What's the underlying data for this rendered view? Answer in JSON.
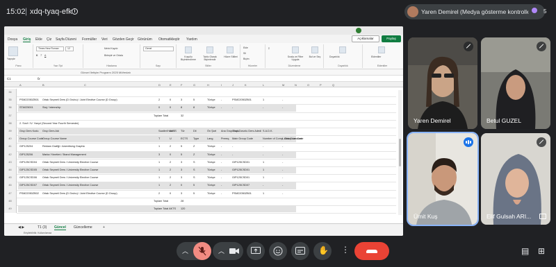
{
  "meet": {
    "time": "15:02",
    "meeting_code": "xdq-tyaq-efk",
    "presenter_label": "Yaren Demirel (Medya gösterme kontrolleri)",
    "participant_count": "5"
  },
  "participants": [
    {
      "name": "Yaren Demirel",
      "mic": "muted"
    },
    {
      "name": "Betul GUZEL",
      "mic": "muted"
    },
    {
      "name": "Ümit Kuş",
      "mic": "speaking"
    },
    {
      "name": "Elif Gulsah ARI...",
      "mic": "muted"
    }
  ],
  "excel": {
    "menu_tabs": [
      "Dosya",
      "Giriş",
      "Ekle",
      "Çiz",
      "Sayfa Düzeni",
      "Formüller",
      "Veri",
      "Gözden Geçir",
      "Görünüm",
      "Otomatikleştir",
      "Yardım"
    ],
    "active_tab": "Giriş",
    "comments_label": "Açıklamalar",
    "share_label": "Paylaş",
    "ribbon": {
      "paste": "Yapıştır",
      "font_name": "Times New Roman",
      "font_size": "12",
      "wrap_text": "Metni Kaydır",
      "merge_center": "Birleştir ve Ortala",
      "number_format": "Genel",
      "cond_format": "Koşullu Biçimlendirme",
      "format_table": "Tablo Olarak Biçimlendir",
      "cell_styles": "Hücre Stilleri",
      "insert": "Ekle",
      "delete": "Sil",
      "format": "Biçim",
      "sort_filter": "Sırala ve Filtre Uygula",
      "find_select": "Bul ve Seç",
      "sensitivity": "Duyarlılık",
      "addins": "Eklentiler",
      "groups": [
        "Pano",
        "Yazı Tipi",
        "Hizalama",
        "Sayı",
        "Stiller",
        "Hücreler",
        "Düzenleme",
        "Duyarlılık",
        "Eklentiler"
      ]
    },
    "info_bar": "Güncel İletişim Programı 2025 Müfredatı",
    "name_box": "C1",
    "formula_icon": "fx",
    "columns": [
      "A",
      "B",
      "C",
      "D",
      "E",
      "F",
      "G",
      "H",
      "I",
      "J",
      "K",
      "L",
      "M",
      "N",
      "O",
      "P",
      "Q"
    ],
    "sheet_tabs": [
      "T1 (3)",
      "Güncel",
      "Güncelleme"
    ],
    "active_sheet": "Güncel",
    "status": "Erişilebilirlik: Kullanılamaz",
    "rows": [
      {
        "n": "34",
        "code": "",
        "name": "",
        "vals": [],
        "shade": false
      },
      {
        "n": "35",
        "code": "PSM22050ZB01",
        "name": "Ortak Seçmeli Ders (D Grubu) / Joint Elective Course (D Group)",
        "vals": [
          "2",
          "0",
          "3",
          "5",
          "Türkçe",
          "-",
          "PSM22050ZB01\nBIT, BIT, BIT",
          "1",
          "-"
        ],
        "shade": false
      },
      {
        "n": "36",
        "code": "STA025001",
        "name": "Staj / Internship",
        "vals": [
          "0",
          "0",
          "8",
          "8",
          "Türkçe",
          "-",
          "-",
          "-",
          "-"
        ],
        "shade": true
      },
      {
        "n": "37",
        "code": "",
        "name": "",
        "vals": [
          "Toplam Total",
          "32"
        ],
        "shade": false
      },
      {
        "n": "38",
        "code": "2. Sınıf / IV. Yarıyıl (Second Year Fourth Semester)",
        "name": "",
        "vals": [],
        "shade": false
      },
      {
        "n": "39",
        "code": "Grup Ders Kodu",
        "name": "Grup Ders Adı",
        "vals": [
          "Saatler/Hours",
          "AKTS",
          "Tür",
          "Dil",
          "Ön Şart",
          "Ana Grup Kodu",
          "Grup Zorunlu Ders Adedi",
          "S.A.D.K."
        ],
        "shade": true
      },
      {
        "n": "40",
        "code": "Group Course Code",
        "name": "Group Course Name",
        "vals": [
          "T",
          "U",
          "ECTS",
          "Type",
          "Lang",
          "Prereq.",
          "Main Group Code",
          "Number of Comp. Group Lessons",
          "L.Aktv.Cour. Code"
        ],
        "shade": true
      },
      {
        "n": "41",
        "code": "GIP125204",
        "name": "Reklam Grafiği / Advertising Graphic",
        "vals": [
          "1",
          "2",
          "5",
          "Z",
          "Türkçe",
          "-",
          "-",
          "-",
          "-"
        ],
        "shade": false
      },
      {
        "n": "42",
        "code": "GIP125206",
        "name": "Marka Yönetimi / Brand Management",
        "vals": [
          "3",
          "0",
          "5",
          "Z",
          "Türkçe",
          "-",
          "-",
          "-",
          "-"
        ],
        "shade": true
      },
      {
        "n": "43",
        "code": "GIP125CSD04",
        "name": "Ortak Seçmeli Ders / University Elective Course",
        "vals": [
          "1",
          "2",
          "3",
          "S",
          "Türkçe",
          "-",
          "GIP125CSD01",
          "1",
          "-"
        ],
        "shade": false
      },
      {
        "n": "44",
        "code": "GIP125CSD05",
        "name": "Ortak Seçmeli Ders / University Elective Course",
        "vals": [
          "1",
          "2",
          "3",
          "S",
          "Türkçe",
          "-",
          "GIP125CSD01",
          "1",
          "-"
        ],
        "shade": true
      },
      {
        "n": "45",
        "code": "GIP125CSD06",
        "name": "Ortak Seçmeli Ders / University Elective Course",
        "vals": [
          "1",
          "2",
          "3",
          "S",
          "Türkçe",
          "-",
          "GIP125CSD01",
          "1",
          "-"
        ],
        "shade": false
      },
      {
        "n": "46",
        "code": "GIP125CSD07",
        "name": "Ortak Seçmeli Ders / University Elective Course",
        "vals": [
          "1",
          "2",
          "0",
          "5",
          "Türkçe",
          "-",
          "GIP125CSD07",
          "-",
          "-"
        ],
        "shade": true
      },
      {
        "n": "47",
        "code": "PSM22050ZB02",
        "name": "Ortak Seçmeli Ders (D Grubu) / Joint Elective Course (D Group)",
        "vals": [
          "2",
          "0",
          "3",
          "5",
          "Türkçe",
          "-",
          "PSM22050ZB01",
          "1",
          "-"
        ],
        "shade": false
      },
      {
        "n": "48",
        "code": "",
        "name": "",
        "vals": [
          "Toplam Total",
          "28"
        ],
        "shade": false
      },
      {
        "n": "49",
        "code": "",
        "name": "",
        "vals": [
          "Toplam Total AKTS",
          "120"
        ],
        "shade": true
      }
    ]
  },
  "controls": {
    "colors": {
      "end_call": "#ea4335",
      "mic_muted": "#f28b82",
      "bar": "#3c4043"
    },
    "icons": [
      "chevron-up-icon",
      "mic-off-icon",
      "chevron-up-icon",
      "camera-icon",
      "present-icon",
      "emoji-icon",
      "captions-icon",
      "raise-hand-icon",
      "more-icon",
      "end-call-icon",
      "chat-icon",
      "activities-icon"
    ]
  }
}
